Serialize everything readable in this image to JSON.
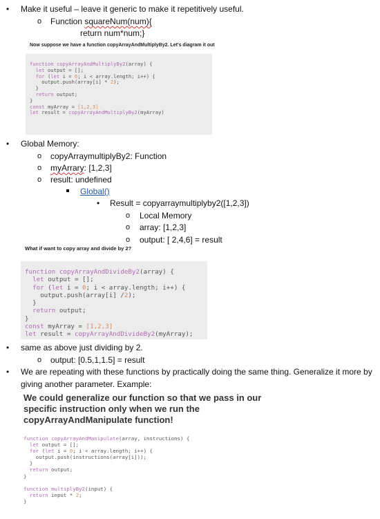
{
  "bullets": {
    "b1": "Make it useful – leave it generic to make it repetitively useful.",
    "b1_sub1_prefix": "Function ",
    "b1_sub1_func": "squareNum(num){",
    "b1_sub1_line2": "return num*num;}",
    "b2": "Global Memory:",
    "b2_sub1": "copyArraymultiplyBy2: Function",
    "b2_sub2_name": "myArrary",
    "b2_sub2_rest": ": [1,2,3]",
    "b2_sub3": "result: undefined",
    "b2_sub3_sub1": "Global()",
    "b2_deep1": "Result = copyarraymultiplyby2([1,2,3])",
    "b2_deep2": "Local Memory",
    "b2_deep3": "array: [1,2,3]",
    "b2_deep4": "output: [ 2,4,6] = result",
    "b3": "same as above just dividing by 2.",
    "b3_sub1": "output: [0.5,1,1.5] = result",
    "b4_line1": "We are repeating with these functions by practically doing the same thing. Generalize it more by",
    "b4_line2": "giving another parameter. Example:"
  },
  "image1": {
    "caption": "Now suppose we have a function copyArrayAndMultiplyBy2. Let's diagram it out",
    "code": [
      "function copyArrayAndMultiplyBy2(array) {",
      "  let output = [];",
      "  for (let i = 0; i < array.length; i++) {",
      "    output.push(array[i] * 2);",
      "  }",
      "  return output;",
      "}",
      "const myArray = [1,2,3]",
      "let result = copyArrayAndMultiplyBy2(myArray)"
    ]
  },
  "image2": {
    "caption": "What if want to copy array and divide by 2?",
    "code": [
      "function copyArrayAndDivideBy2(array) {",
      "  let output = [];",
      "  for (let i = 0; i < array.length; i++) {",
      "    output.push(array[i] /2);",
      "  }",
      "  return output;",
      "}",
      "const myArray = [1,2,3]",
      "let result = copyArrayAndDivideBy2(myArray);"
    ]
  },
  "image3": {
    "caption_lines": [
      "We could generalize our function so that we pass in our",
      "specific instruction only when we run the",
      "copyArrayAndManipulate function!"
    ],
    "code": [
      "function copyArrayAndManipulate(array, instructions) {",
      "  let output = [];",
      "  for (let i = 0; i < array.length; i++) {",
      "    output.push(instructions(array[i]));",
      "  }",
      "  return output;",
      "}",
      "",
      "function multiplyBy2(input) {",
      "  return input * 2;",
      "}"
    ]
  }
}
